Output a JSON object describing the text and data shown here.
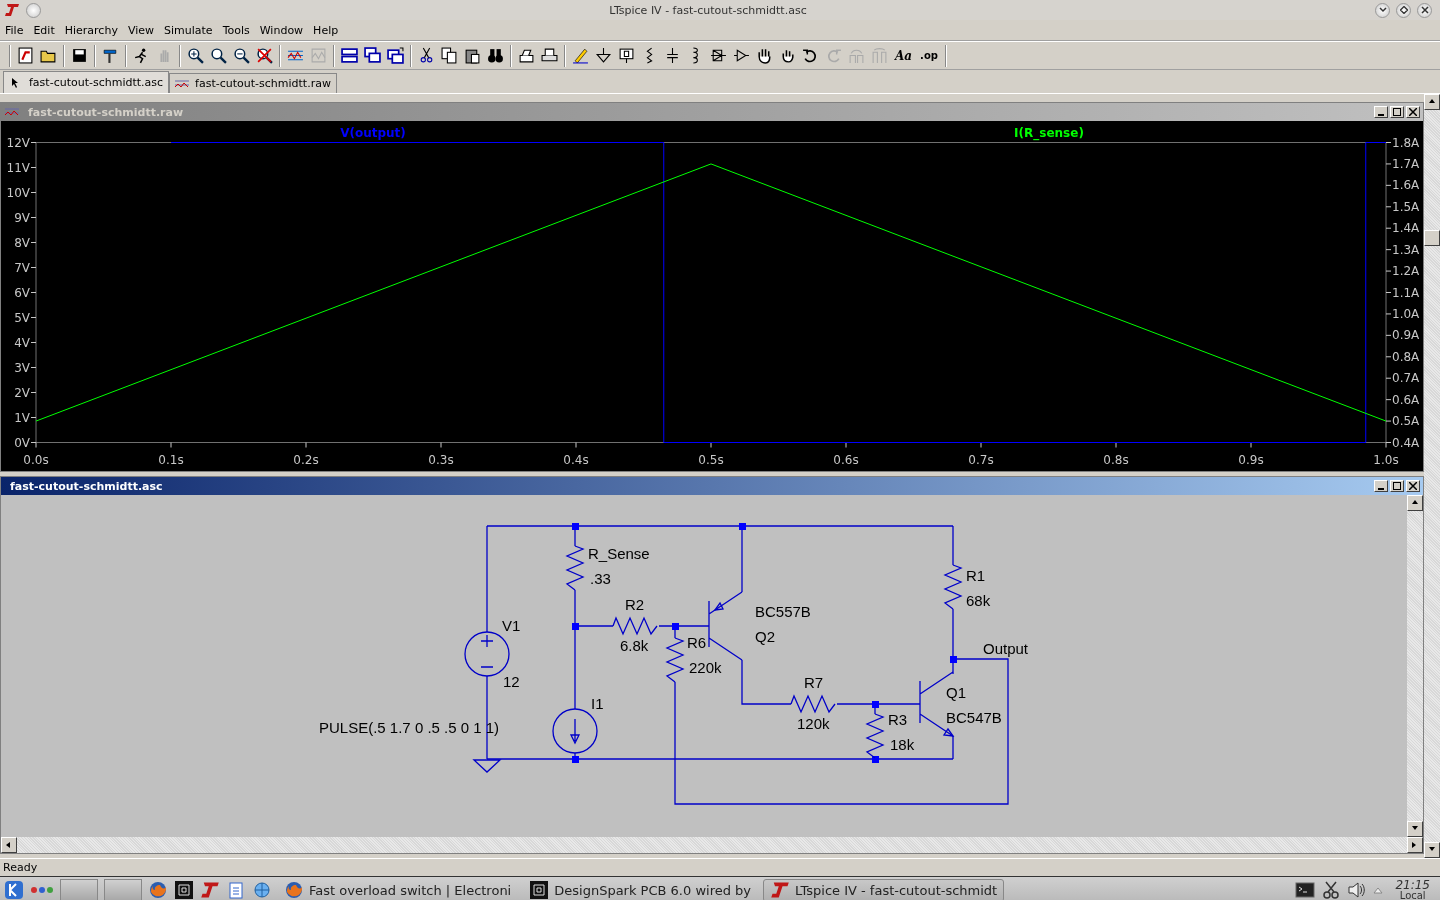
{
  "window": {
    "title": "LTspice IV - fast-cutout-schmidtt.asc"
  },
  "menu": [
    "File",
    "Edit",
    "Hierarchy",
    "View",
    "Simulate",
    "Tools",
    "Window",
    "Help"
  ],
  "toolbar": {
    "text_tools": [
      "Aa",
      ".op"
    ]
  },
  "tabs": [
    {
      "label": "fast-cutout-schmidtt.asc",
      "kind": "schematic",
      "selected": true
    },
    {
      "label": "fast-cutout-schmidtt.raw",
      "kind": "waveform",
      "selected": false
    }
  ],
  "plot_window": {
    "title": "fast-cutout-schmidtt.raw",
    "chart_data": {
      "type": "line",
      "xlim": [
        0,
        1
      ],
      "ylim": [
        0,
        12
      ],
      "y2lim": [
        0.4,
        1.8
      ],
      "xticks": [
        {
          "value": 0,
          "label": "0.0s"
        },
        {
          "value": 0.1,
          "label": "0.1s"
        },
        {
          "value": 0.2,
          "label": "0.2s"
        },
        {
          "value": 0.3,
          "label": "0.3s"
        },
        {
          "value": 0.4,
          "label": "0.4s"
        },
        {
          "value": 0.5,
          "label": "0.5s"
        },
        {
          "value": 0.6,
          "label": "0.6s"
        },
        {
          "value": 0.7,
          "label": "0.7s"
        },
        {
          "value": 0.8,
          "label": "0.8s"
        },
        {
          "value": 0.9,
          "label": "0.9s"
        },
        {
          "value": 1,
          "label": "1.0s"
        }
      ],
      "yticks": [
        {
          "value": 0,
          "label": "0V"
        },
        {
          "value": 1,
          "label": "1V"
        },
        {
          "value": 2,
          "label": "2V"
        },
        {
          "value": 3,
          "label": "3V"
        },
        {
          "value": 4,
          "label": "4V"
        },
        {
          "value": 5,
          "label": "5V"
        },
        {
          "value": 6,
          "label": "6V"
        },
        {
          "value": 7,
          "label": "7V"
        },
        {
          "value": 8,
          "label": "8V"
        },
        {
          "value": 9,
          "label": "9V"
        },
        {
          "value": 10,
          "label": "10V"
        },
        {
          "value": 11,
          "label": "11V"
        },
        {
          "value": 12,
          "label": "12V"
        }
      ],
      "y2ticks": [
        {
          "value": 0.4,
          "label": "0.4A"
        },
        {
          "value": 0.5,
          "label": "0.5A"
        },
        {
          "value": 0.6,
          "label": "0.6A"
        },
        {
          "value": 0.7,
          "label": "0.7A"
        },
        {
          "value": 0.8,
          "label": "0.8A"
        },
        {
          "value": 0.9,
          "label": "0.9A"
        },
        {
          "value": 1.0,
          "label": "1.0A"
        },
        {
          "value": 1.1,
          "label": "1.1A"
        },
        {
          "value": 1.2,
          "label": "1.2A"
        },
        {
          "value": 1.3,
          "label": "1.3A"
        },
        {
          "value": 1.4,
          "label": "1.4A"
        },
        {
          "value": 1.5,
          "label": "1.5A"
        },
        {
          "value": 1.6,
          "label": "1.6A"
        },
        {
          "value": 1.7,
          "label": "1.7A"
        },
        {
          "value": 1.8,
          "label": "1.8A"
        }
      ],
      "series": [
        {
          "name": "V(output)",
          "color": "#0000ff",
          "x": [
            0.1,
            0.465,
            0.465,
            0.985,
            0.985,
            1
          ],
          "values": [
            12,
            12,
            0,
            0,
            12,
            12
          ]
        },
        {
          "name": "I(R_sense)",
          "color": "#00ff00",
          "axis": "y2",
          "x": [
            0,
            0.5,
            1
          ],
          "values": [
            0.5,
            1.7,
            0.5
          ]
        }
      ]
    }
  },
  "schematic_window": {
    "title": "fast-cutout-schmidtt.asc",
    "net_labels": [
      "Output"
    ],
    "components": [
      {
        "kind": "voltage_source",
        "name": "V1",
        "value": "12"
      },
      {
        "kind": "current_source",
        "name": "I1",
        "value": "PULSE(.5 1.7 0 .5 .5 0 1 1)"
      },
      {
        "kind": "resistor",
        "name": "R_Sense",
        "value": ".33"
      },
      {
        "kind": "resistor",
        "name": "R2",
        "value": "6.8k"
      },
      {
        "kind": "resistor",
        "name": "R6",
        "value": "220k"
      },
      {
        "kind": "pnp",
        "name": "Q2",
        "value": "BC557B"
      },
      {
        "kind": "resistor",
        "name": "R7",
        "value": "120k"
      },
      {
        "kind": "resistor",
        "name": "R3",
        "value": "18k"
      },
      {
        "kind": "resistor",
        "name": "R1",
        "value": "68k"
      },
      {
        "kind": "npn",
        "name": "Q1",
        "value": "BC547B"
      }
    ]
  },
  "status_bar": "Ready",
  "taskbar": {
    "tasks": [
      {
        "label": "Fast overload switch | Electroni",
        "selected": false
      },
      {
        "label": "DesignSpark PCB 6.0 wired by",
        "selected": false
      },
      {
        "label": "LTspice IV - fast-cutout-schmidt",
        "selected": true
      }
    ],
    "clock": {
      "time": "21:15",
      "zone": "Local"
    }
  }
}
